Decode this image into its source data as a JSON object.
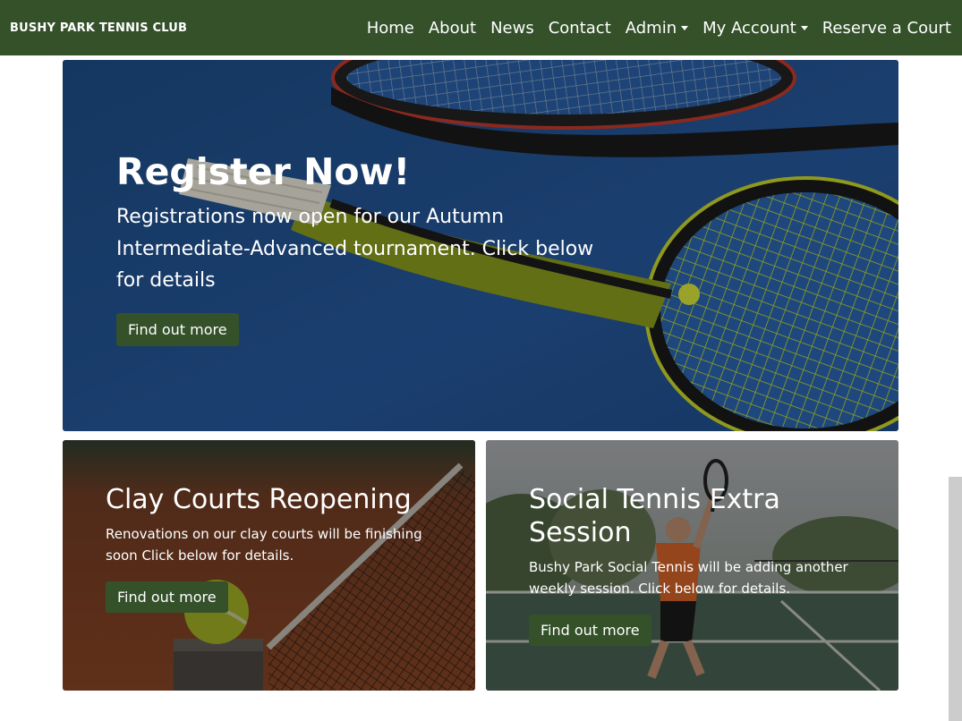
{
  "navbar": {
    "brand": "BUSHY PARK TENNIS CLUB",
    "links": [
      {
        "label": "Home"
      },
      {
        "label": "About"
      },
      {
        "label": "News"
      },
      {
        "label": "Contact"
      },
      {
        "label": "Admin"
      },
      {
        "label": "My Account"
      },
      {
        "label": "Reserve a Court"
      }
    ],
    "color": "#34512a"
  },
  "hero": {
    "title": "Register Now!",
    "text": "Registrations now open for our Autumn Intermediate-Advanced tournament. Click below for details",
    "button": "Find out more",
    "image": "tennis-rackets-image"
  },
  "cards": [
    {
      "title": "Clay Courts Reopening",
      "text": "Renovations on our clay courts will be finishing soon Click below for details.",
      "button": "Find out more",
      "image": "tennis-net-ball-image"
    },
    {
      "title": "Social Tennis Extra Session",
      "text": "Bushy Park Social Tennis will be adding another weekly session. Click below for details.",
      "button": "Find out more",
      "image": "tennis-player-image"
    }
  ]
}
